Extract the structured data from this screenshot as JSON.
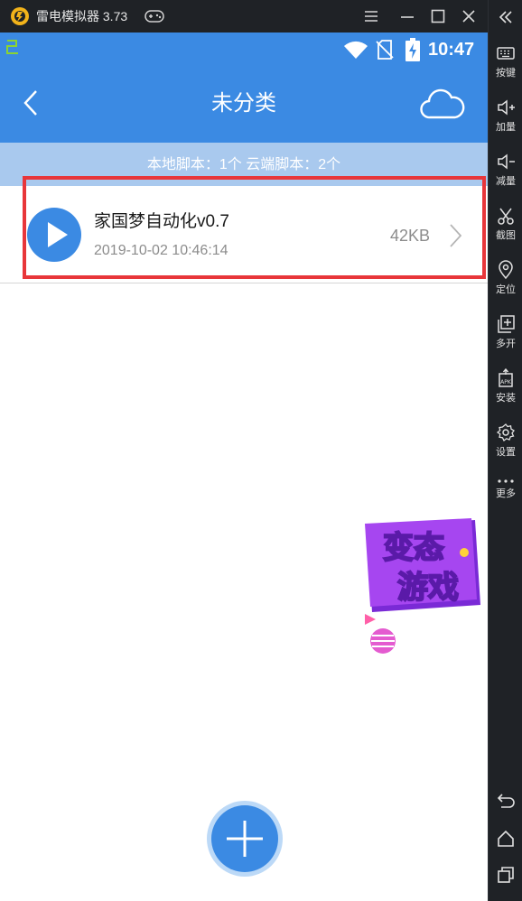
{
  "emulator": {
    "title": "雷电模拟器 3.73",
    "icons": [
      "leidian-logo-icon",
      "gamepad-icon",
      "menu-icon",
      "minimize-icon",
      "maximize-icon",
      "close-icon",
      "collapse-icon"
    ]
  },
  "sidebar": {
    "items": [
      {
        "label": "按键",
        "icon": "keyboard-icon"
      },
      {
        "label": "加量",
        "icon": "volume-up-icon"
      },
      {
        "label": "减量",
        "icon": "volume-down-icon"
      },
      {
        "label": "截图",
        "icon": "scissors-icon"
      },
      {
        "label": "定位",
        "icon": "location-icon"
      },
      {
        "label": "多开",
        "icon": "multi-instance-icon"
      },
      {
        "label": "安装",
        "icon": "apk-install-icon"
      },
      {
        "label": "设置",
        "icon": "gear-icon"
      },
      {
        "label": "更多",
        "icon": "more-icon"
      }
    ],
    "nav": [
      "back-icon",
      "home-icon",
      "recents-icon"
    ]
  },
  "statusbar": {
    "time": "10:47",
    "icons": [
      "notification-icon",
      "wifi-icon",
      "no-sim-icon",
      "battery-charging-icon"
    ]
  },
  "appbar": {
    "title": "未分类",
    "icons": [
      "back-arrow-icon",
      "cloud-icon"
    ]
  },
  "summary": {
    "text": "本地脚本：1个 云端脚本：2个"
  },
  "scripts": [
    {
      "name": "家国梦自动化v0.7",
      "date": "2019-10-02 10:46:14",
      "size": "42KB"
    }
  ],
  "promo": {
    "text": "变态游戏",
    "line1": "变态",
    "line2": "游戏"
  },
  "colors": {
    "primary": "#3b8ae3",
    "summary_bg": "#a9c9ee",
    "highlight": "#e8363a",
    "emulator_bg": "#1f2226"
  }
}
